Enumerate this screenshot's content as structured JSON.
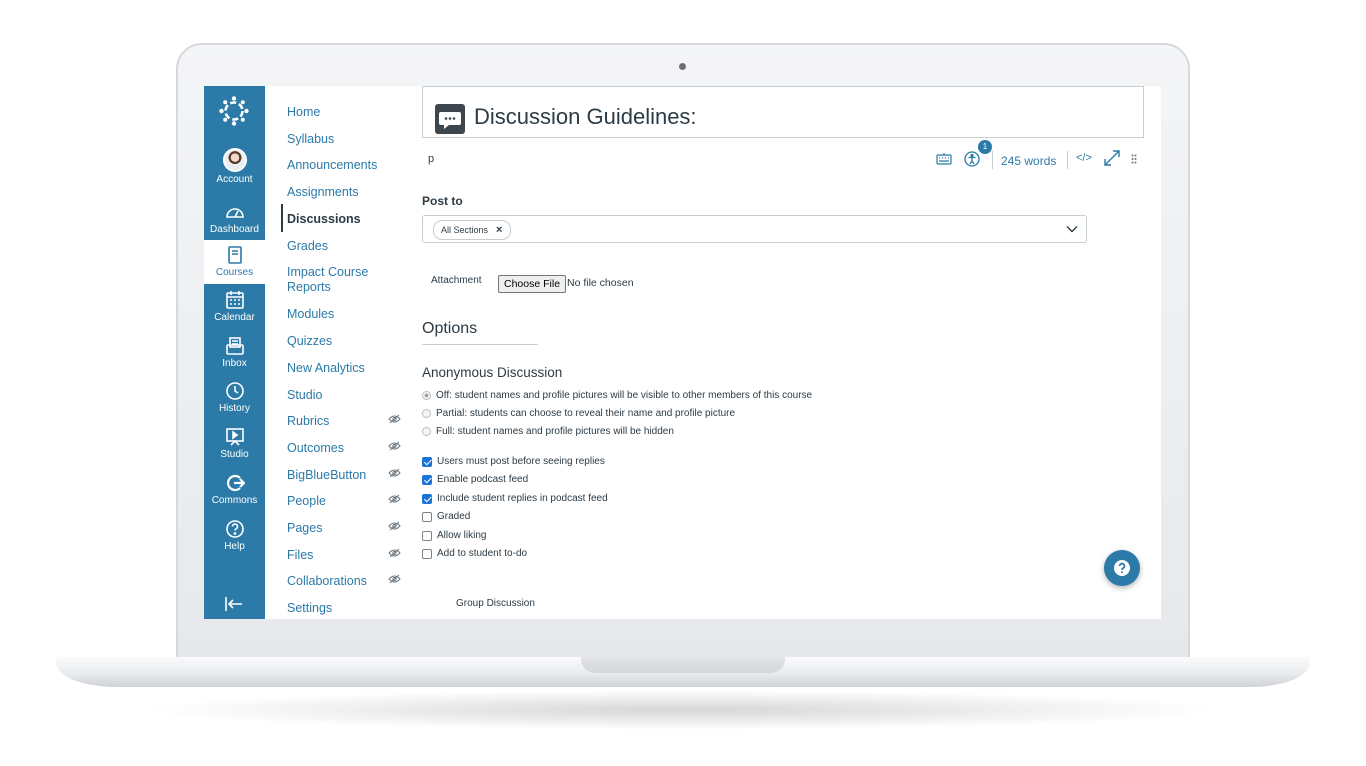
{
  "global_nav": {
    "items": [
      {
        "label": "Account",
        "icon": "avatar"
      },
      {
        "label": "Dashboard",
        "icon": "dashboard-icon"
      },
      {
        "label": "Courses",
        "icon": "courses-icon"
      },
      {
        "label": "Calendar",
        "icon": "calendar-icon"
      },
      {
        "label": "Inbox",
        "icon": "inbox-icon"
      },
      {
        "label": "History",
        "icon": "history-icon"
      },
      {
        "label": "Studio",
        "icon": "studio-icon"
      },
      {
        "label": "Commons",
        "icon": "commons-icon"
      },
      {
        "label": "Help",
        "icon": "help-icon"
      }
    ],
    "active": "Courses",
    "accent": "#2b7aa8"
  },
  "course_nav": {
    "items": [
      {
        "label": "Home"
      },
      {
        "label": "Syllabus"
      },
      {
        "label": "Announcements"
      },
      {
        "label": "Assignments"
      },
      {
        "label": "Discussions"
      },
      {
        "label": "Grades"
      },
      {
        "label": "Impact Course Reports"
      },
      {
        "label": "Modules"
      },
      {
        "label": "Quizzes"
      },
      {
        "label": "New Analytics"
      },
      {
        "label": "Studio"
      },
      {
        "label": "Rubrics",
        "hidden": true
      },
      {
        "label": "Outcomes",
        "hidden": true
      },
      {
        "label": "BigBlueButton",
        "hidden": true
      },
      {
        "label": "People",
        "hidden": true
      },
      {
        "label": "Pages",
        "hidden": true
      },
      {
        "label": "Files",
        "hidden": true
      },
      {
        "label": "Collaborations",
        "hidden": true
      },
      {
        "label": "Settings"
      }
    ],
    "active": "Discussions"
  },
  "editor": {
    "title": "Discussion Guidelines:",
    "path_tag": "p",
    "a11y_badge": "1",
    "word_count": "245 words",
    "html_toggle": "</>"
  },
  "post_to": {
    "label": "Post to",
    "selected_pill": "All Sections",
    "pill_remove": "×"
  },
  "attachment": {
    "label": "Attachment",
    "button": "Choose File",
    "status": "No file chosen"
  },
  "options": {
    "heading": "Options",
    "anonymous_heading": "Anonymous Discussion",
    "radios": [
      {
        "label": "Off: student names and profile pictures will be visible to other members of this course",
        "checked": true
      },
      {
        "label": "Partial: students can choose to reveal their name and profile picture",
        "checked": false
      },
      {
        "label": "Full: student names and profile pictures will be hidden",
        "checked": false
      }
    ],
    "checkboxes": [
      {
        "label": "Users must post before seeing replies",
        "checked": true
      },
      {
        "label": "Enable podcast feed",
        "checked": true
      },
      {
        "label": "Include student replies in podcast feed",
        "checked": true
      },
      {
        "label": "Graded",
        "checked": false
      },
      {
        "label": "Allow liking",
        "checked": false
      },
      {
        "label": "Add to student to-do",
        "checked": false
      }
    ],
    "group_label": "Group Discussion"
  }
}
